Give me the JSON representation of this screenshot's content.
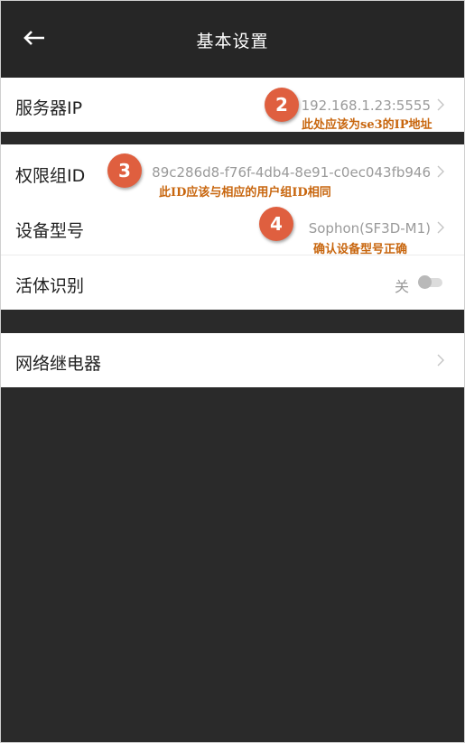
{
  "header": {
    "title": "基本设置",
    "back_icon": "back-arrow-icon"
  },
  "server_ip": {
    "label": "服务器IP",
    "value": "192.168.1.23:5555",
    "badge": "2",
    "note": "此处应该为se3的IP地址"
  },
  "group_id": {
    "label": "权限组ID",
    "value": "89c286d8-f76f-4db4-8e91-c0ec043fb946",
    "badge": "3",
    "note": "此ID应该与相应的用户组ID相同"
  },
  "device_model": {
    "label": "设备型号",
    "value": "Sophon(SF3D-M1)",
    "badge": "4",
    "note": "确认设备型号正确"
  },
  "liveness": {
    "label": "活体识别",
    "state_text": "关"
  },
  "relay": {
    "label": "网络继电器"
  },
  "colors": {
    "badge": "#df5f3f",
    "note": "#c8660e",
    "header_bg": "#262626",
    "page_bg": "#2a2a2a"
  }
}
